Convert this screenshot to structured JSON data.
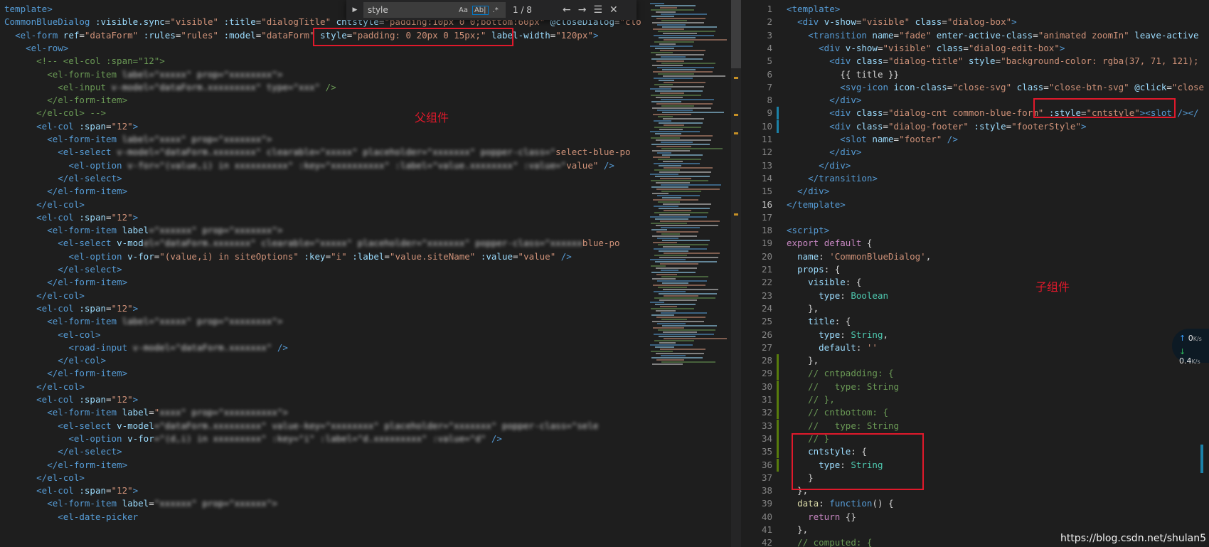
{
  "find_widget": {
    "query": "style",
    "match_count": "1 / 8",
    "option_case": "Aa",
    "option_word": "Ab|",
    "option_regex": ".*"
  },
  "annotations": {
    "parent_label": "父组件",
    "child_label": "子组件"
  },
  "left_code": [
    [
      [
        "tag",
        "template>"
      ]
    ],
    [
      [
        "tag",
        "CommonBlueDialog "
      ],
      [
        "attr",
        ":visible.sync"
      ],
      [
        "pl",
        "="
      ],
      [
        "str",
        "\"visible\" "
      ],
      [
        "attr",
        ":title"
      ],
      [
        "pl",
        "="
      ],
      [
        "str",
        "\"dialogTitle\" "
      ],
      [
        "attr",
        "cntstyle"
      ],
      [
        "pl",
        "="
      ],
      [
        "str",
        "\"padding:10px 0 0;bottom:60px\" "
      ],
      [
        "attr",
        "@closeDialog"
      ],
      [
        "pl",
        "="
      ],
      [
        "str",
        "\"clo"
      ]
    ],
    [
      [
        "pl",
        "  "
      ],
      [
        "tag",
        "<el-form "
      ],
      [
        "attr",
        "ref"
      ],
      [
        "pl",
        "="
      ],
      [
        "str",
        "\"dataForm\" "
      ],
      [
        "attr",
        ":rules"
      ],
      [
        "pl",
        "="
      ],
      [
        "str",
        "\"rules\" "
      ],
      [
        "attr",
        ":model"
      ],
      [
        "pl",
        "="
      ],
      [
        "str",
        "\"dataForm\" "
      ],
      [
        "attr",
        "style"
      ],
      [
        "pl",
        "="
      ],
      [
        "str",
        "\"padding: 0 20px 0 15px;\" "
      ],
      [
        "attr",
        "label-width"
      ],
      [
        "pl",
        "="
      ],
      [
        "str",
        "\"120px\""
      ],
      [
        "tag",
        ">"
      ]
    ],
    [
      [
        "pl",
        "    "
      ],
      [
        "tag",
        "<el-row>"
      ]
    ],
    [
      [
        "pl",
        "      "
      ],
      [
        "com",
        "<!-- <el-col :span=\"12\">"
      ]
    ],
    [
      [
        "pl",
        "        "
      ],
      [
        "com",
        "<el-form-item "
      ],
      [
        "blur",
        "label=\"xxxxx\" prop=\"xxxxxxxx\">"
      ]
    ],
    [
      [
        "pl",
        "          "
      ],
      [
        "com",
        "<el-input "
      ],
      [
        "blur",
        "v-model=\"dataForm.xxxxxxxxx\" type=\"xxx\" "
      ],
      [
        "com",
        "/>"
      ]
    ],
    [
      [
        "pl",
        "        "
      ],
      [
        "com",
        "</el-form-item>"
      ]
    ],
    [
      [
        "pl",
        "      "
      ],
      [
        "com",
        "</el-col> -->"
      ]
    ],
    [
      [
        "pl",
        "      "
      ],
      [
        "tag",
        "<el-col "
      ],
      [
        "attr",
        ":span"
      ],
      [
        "pl",
        "="
      ],
      [
        "str",
        "\"12\""
      ],
      [
        "tag",
        ">"
      ]
    ],
    [
      [
        "pl",
        "        "
      ],
      [
        "tag",
        "<el-form-item "
      ],
      [
        "blur",
        "label=\"xxxx\" prop=\"xxxxxxx\">"
      ]
    ],
    [
      [
        "pl",
        "          "
      ],
      [
        "tag",
        "<el-select "
      ],
      [
        "blur",
        "v-model=\"dataForm.xxxxxxxx\" clearable=\"xxxxx\" placeholder=\"xxxxxxx\" popper-class=\""
      ],
      [
        "str",
        "select-blue-po"
      ]
    ],
    [
      [
        "pl",
        "            "
      ],
      [
        "tag",
        "<el-option "
      ],
      [
        "blur",
        "v-for=\"(value,i) in xxxxxxxxxx\" :key=\"xxxxxxxxxx\" :label=\"value.xxxxxxxx\" :value=\""
      ],
      [
        "str",
        "value\" "
      ],
      [
        "tag",
        "/>"
      ]
    ],
    [
      [
        "pl",
        "          "
      ],
      [
        "tag",
        "</el-select>"
      ]
    ],
    [
      [
        "pl",
        "        "
      ],
      [
        "tag",
        "</el-form-item>"
      ]
    ],
    [
      [
        "pl",
        "      "
      ],
      [
        "tag",
        "</el-col>"
      ]
    ],
    [
      [
        "pl",
        "      "
      ],
      [
        "tag",
        "<el-col "
      ],
      [
        "attr",
        ":span"
      ],
      [
        "pl",
        "="
      ],
      [
        "str",
        "\"12\""
      ],
      [
        "tag",
        ">"
      ]
    ],
    [
      [
        "pl",
        "        "
      ],
      [
        "tag",
        "<el-form-item "
      ],
      [
        "attr",
        "label"
      ],
      [
        "blur",
        "=\"xxxxxx\" prop=\"xxxxxxx\">"
      ]
    ],
    [
      [
        "pl",
        "          "
      ],
      [
        "tag",
        "<el-select "
      ],
      [
        "attr",
        "v-mod"
      ],
      [
        "blur",
        "el=\"dataForm.xxxxxxx\" clearable=\"xxxxx\" placeholder=\"xxxxxxx\" popper-class=\"xxxxxx"
      ],
      [
        "str",
        "blue-po"
      ]
    ],
    [
      [
        "pl",
        "            "
      ],
      [
        "tag",
        "<el-option "
      ],
      [
        "attr",
        "v-for"
      ],
      [
        "pl",
        "="
      ],
      [
        "str",
        "\"(value,i) in siteOptions\" "
      ],
      [
        "attr",
        ":key"
      ],
      [
        "pl",
        "="
      ],
      [
        "str",
        "\"i\" "
      ],
      [
        "attr",
        ":label"
      ],
      [
        "pl",
        "="
      ],
      [
        "str",
        "\"value.siteName\" "
      ],
      [
        "attr",
        ":value"
      ],
      [
        "pl",
        "="
      ],
      [
        "str",
        "\"value\" "
      ],
      [
        "tag",
        "/>"
      ]
    ],
    [
      [
        "pl",
        "          "
      ],
      [
        "tag",
        "</el-select>"
      ]
    ],
    [
      [
        "pl",
        "        "
      ],
      [
        "tag",
        "</el-form-item>"
      ]
    ],
    [
      [
        "pl",
        "      "
      ],
      [
        "tag",
        "</el-col>"
      ]
    ],
    [
      [
        "pl",
        "      "
      ],
      [
        "tag",
        "<el-col "
      ],
      [
        "attr",
        ":span"
      ],
      [
        "pl",
        "="
      ],
      [
        "str",
        "\"12\""
      ],
      [
        "tag",
        ">"
      ]
    ],
    [
      [
        "pl",
        "        "
      ],
      [
        "tag",
        "<el-form-item "
      ],
      [
        "blur",
        "label=\"xxxxx\" prop=\"xxxxxxxx\">"
      ]
    ],
    [
      [
        "pl",
        "          "
      ],
      [
        "tag",
        "<el-col>"
      ]
    ],
    [
      [
        "pl",
        "            "
      ],
      [
        "tag",
        "<road-input "
      ],
      [
        "blur",
        "v-model=\"dataForm.xxxxxxx\" "
      ],
      [
        "tag",
        "/>"
      ]
    ],
    [
      [
        "pl",
        "          "
      ],
      [
        "tag",
        "</el-col>"
      ]
    ],
    [
      [
        "pl",
        "        "
      ],
      [
        "tag",
        "</el-form-item>"
      ]
    ],
    [
      [
        "pl",
        "      "
      ],
      [
        "tag",
        "</el-col>"
      ]
    ],
    [
      [
        "pl",
        "      "
      ],
      [
        "tag",
        "<el-col "
      ],
      [
        "attr",
        ":span"
      ],
      [
        "pl",
        "="
      ],
      [
        "str",
        "\"12\""
      ],
      [
        "tag",
        ">"
      ]
    ],
    [
      [
        "pl",
        "        "
      ],
      [
        "tag",
        "<el-form-item "
      ],
      [
        "attr",
        "label"
      ],
      [
        "pl",
        "="
      ],
      [
        "str",
        "\""
      ],
      [
        "blur",
        "xxxx\" prop=\"xxxxxxxxxx\">"
      ]
    ],
    [
      [
        "pl",
        "          "
      ],
      [
        "tag",
        "<el-select "
      ],
      [
        "attr",
        "v-model"
      ],
      [
        "blur",
        "=\"dataForm.xxxxxxxxx\" value-key=\"xxxxxxxx\" placeholder=\"xxxxxxx\" popper-class=\"sele"
      ]
    ],
    [
      [
        "pl",
        "            "
      ],
      [
        "tag",
        "<el-option "
      ],
      [
        "attr",
        "v-for"
      ],
      [
        "blur",
        "=\"(d,i) in xxxxxxxxx\" :key=\"i\" :label=\"d.xxxxxxxxx\" :value=\"d\" "
      ],
      [
        "tag",
        "/>"
      ]
    ],
    [
      [
        "pl",
        "          "
      ],
      [
        "tag",
        "</el-select>"
      ]
    ],
    [
      [
        "pl",
        "        "
      ],
      [
        "tag",
        "</el-form-item>"
      ]
    ],
    [
      [
        "pl",
        "      "
      ],
      [
        "tag",
        "</el-col>"
      ]
    ],
    [
      [
        "pl",
        "      "
      ],
      [
        "tag",
        "<el-col "
      ],
      [
        "attr",
        ":span"
      ],
      [
        "pl",
        "="
      ],
      [
        "str",
        "\"12\""
      ],
      [
        "tag",
        ">"
      ]
    ],
    [
      [
        "pl",
        "        "
      ],
      [
        "tag",
        "<el-form-item "
      ],
      [
        "attr",
        "label"
      ],
      [
        "pl",
        "="
      ],
      [
        "blur",
        "\"xxxxxx\" prop=\"xxxxxx\">"
      ]
    ],
    [
      [
        "pl",
        "          "
      ],
      [
        "tag",
        "<el-date-picker"
      ]
    ]
  ],
  "right_code": [
    [
      [
        "tag",
        "<template>"
      ]
    ],
    [
      [
        "pl",
        "  "
      ],
      [
        "tag",
        "<div "
      ],
      [
        "attr",
        "v-show"
      ],
      [
        "pl",
        "="
      ],
      [
        "str",
        "\"visible\" "
      ],
      [
        "attr",
        "class"
      ],
      [
        "pl",
        "="
      ],
      [
        "str",
        "\"dialog-box\""
      ],
      [
        "tag",
        ">"
      ]
    ],
    [
      [
        "pl",
        "    "
      ],
      [
        "tag",
        "<transition "
      ],
      [
        "attr",
        "name"
      ],
      [
        "pl",
        "="
      ],
      [
        "str",
        "\"fade\" "
      ],
      [
        "attr",
        "enter-active-class"
      ],
      [
        "pl",
        "="
      ],
      [
        "str",
        "\"animated zoomIn\" "
      ],
      [
        "attr",
        "leave-active"
      ]
    ],
    [
      [
        "pl",
        "      "
      ],
      [
        "tag",
        "<div "
      ],
      [
        "attr",
        "v-show"
      ],
      [
        "pl",
        "="
      ],
      [
        "str",
        "\"visible\" "
      ],
      [
        "attr",
        "class"
      ],
      [
        "pl",
        "="
      ],
      [
        "str",
        "\"dialog-edit-box\""
      ],
      [
        "tag",
        ">"
      ]
    ],
    [
      [
        "pl",
        "        "
      ],
      [
        "tag",
        "<div "
      ],
      [
        "attr",
        "class"
      ],
      [
        "pl",
        "="
      ],
      [
        "str",
        "\"dialog-title\" "
      ],
      [
        "attr",
        "style"
      ],
      [
        "pl",
        "="
      ],
      [
        "str",
        "\"background-color: rgba(37, 71, 121);"
      ]
    ],
    [
      [
        "pl",
        "          "
      ],
      [
        "pl",
        "{{ title }}"
      ]
    ],
    [
      [
        "pl",
        "          "
      ],
      [
        "tag",
        "<svg-icon "
      ],
      [
        "attr",
        "icon-class"
      ],
      [
        "pl",
        "="
      ],
      [
        "str",
        "\"close-svg\" "
      ],
      [
        "attr",
        "class"
      ],
      [
        "pl",
        "="
      ],
      [
        "str",
        "\"close-btn-svg\" "
      ],
      [
        "attr",
        "@click"
      ],
      [
        "pl",
        "="
      ],
      [
        "str",
        "\"close"
      ]
    ],
    [
      [
        "pl",
        "        "
      ],
      [
        "tag",
        "</div>"
      ]
    ],
    [
      [
        "pl",
        "        "
      ],
      [
        "tag",
        "<div "
      ],
      [
        "attr",
        "class"
      ],
      [
        "pl",
        "="
      ],
      [
        "str",
        "\"dialog-cnt common-blue-form\" "
      ],
      [
        "attr",
        ":style"
      ],
      [
        "pl",
        "="
      ],
      [
        "str",
        "\"cntstyle\""
      ],
      [
        "tag",
        "><slot /></"
      ]
    ],
    [
      [
        "pl",
        "        "
      ],
      [
        "tag",
        "<div "
      ],
      [
        "attr",
        "class"
      ],
      [
        "pl",
        "="
      ],
      [
        "str",
        "\"dialog-footer\" "
      ],
      [
        "attr",
        ":style"
      ],
      [
        "pl",
        "="
      ],
      [
        "str",
        "\"footerStyle\""
      ],
      [
        "tag",
        ">"
      ]
    ],
    [
      [
        "pl",
        "          "
      ],
      [
        "tag",
        "<slot "
      ],
      [
        "attr",
        "name"
      ],
      [
        "pl",
        "="
      ],
      [
        "str",
        "\"footer\" "
      ],
      [
        "tag",
        "/>"
      ]
    ],
    [
      [
        "pl",
        "        "
      ],
      [
        "tag",
        "</div>"
      ]
    ],
    [
      [
        "pl",
        "      "
      ],
      [
        "tag",
        "</div>"
      ]
    ],
    [
      [
        "pl",
        "    "
      ],
      [
        "tag",
        "</transition>"
      ]
    ],
    [
      [
        "pl",
        "  "
      ],
      [
        "tag",
        "</div>"
      ]
    ],
    [
      [
        "tag",
        "</template>"
      ]
    ],
    [
      [
        "pl",
        ""
      ]
    ],
    [
      [
        "tag",
        "<script>"
      ]
    ],
    [
      [
        "kw",
        "export "
      ],
      [
        "kw",
        "default "
      ],
      [
        "pl",
        "{"
      ]
    ],
    [
      [
        "pl",
        "  "
      ],
      [
        "attr",
        "name"
      ],
      [
        "pl",
        ": "
      ],
      [
        "str",
        "'CommonBlueDialog'"
      ],
      [
        "pl",
        ","
      ]
    ],
    [
      [
        "pl",
        "  "
      ],
      [
        "attr",
        "props"
      ],
      [
        "pl",
        ": {"
      ]
    ],
    [
      [
        "pl",
        "    "
      ],
      [
        "attr",
        "visible"
      ],
      [
        "pl",
        ": {"
      ]
    ],
    [
      [
        "pl",
        "      "
      ],
      [
        "attr",
        "type"
      ],
      [
        "pl",
        ": "
      ],
      [
        "ty",
        "Boolean"
      ]
    ],
    [
      [
        "pl",
        "    },"
      ]
    ],
    [
      [
        "pl",
        "    "
      ],
      [
        "attr",
        "title"
      ],
      [
        "pl",
        ": {"
      ]
    ],
    [
      [
        "pl",
        "      "
      ],
      [
        "attr",
        "type"
      ],
      [
        "pl",
        ": "
      ],
      [
        "ty",
        "String"
      ],
      [
        "pl",
        ","
      ]
    ],
    [
      [
        "pl",
        "      "
      ],
      [
        "attr",
        "default"
      ],
      [
        "pl",
        ": "
      ],
      [
        "str",
        "''"
      ]
    ],
    [
      [
        "pl",
        "    },"
      ]
    ],
    [
      [
        "pl",
        "    "
      ],
      [
        "com",
        "// cntpadding: {"
      ]
    ],
    [
      [
        "pl",
        "    "
      ],
      [
        "com",
        "//   type: String"
      ]
    ],
    [
      [
        "pl",
        "    "
      ],
      [
        "com",
        "// },"
      ]
    ],
    [
      [
        "pl",
        "    "
      ],
      [
        "com",
        "// cntbottom: {"
      ]
    ],
    [
      [
        "pl",
        "    "
      ],
      [
        "com",
        "//   type: String"
      ]
    ],
    [
      [
        "pl",
        "    "
      ],
      [
        "com",
        "// }"
      ]
    ],
    [
      [
        "pl",
        "    "
      ],
      [
        "attr",
        "cntstyle"
      ],
      [
        "pl",
        ": {"
      ]
    ],
    [
      [
        "pl",
        "      "
      ],
      [
        "attr",
        "type"
      ],
      [
        "pl",
        ": "
      ],
      [
        "ty",
        "String"
      ]
    ],
    [
      [
        "pl",
        "    }"
      ]
    ],
    [
      [
        "pl",
        "  },"
      ]
    ],
    [
      [
        "pl",
        "  "
      ],
      [
        "fn",
        "data"
      ],
      [
        "pl",
        ": "
      ],
      [
        "kw2",
        "function"
      ],
      [
        "pl",
        "() {"
      ]
    ],
    [
      [
        "pl",
        "    "
      ],
      [
        "kw",
        "return "
      ],
      [
        "pl",
        "{}"
      ]
    ],
    [
      [
        "pl",
        "  },"
      ]
    ],
    [
      [
        "pl",
        "  "
      ],
      [
        "com",
        "// computed: {"
      ]
    ]
  ],
  "right_line_numbers": [
    "1",
    "2",
    "3",
    "4",
    "5",
    "6",
    "7",
    "8",
    "9",
    "10",
    "11",
    "12",
    "13",
    "14",
    "15",
    "16",
    "17",
    "18",
    "19",
    "20",
    "21",
    "22",
    "23",
    "24",
    "25",
    "26",
    "27",
    "28",
    "29",
    "30",
    "31",
    "32",
    "33",
    "34",
    "35",
    "36",
    "37",
    "38",
    "39",
    "40",
    "41",
    "42"
  ],
  "active_line": "16",
  "net_widget": {
    "up_value": "0",
    "up_unit": "K/s",
    "down_value": "0.4",
    "down_unit": "K/s"
  },
  "watermark": "https://blog.csdn.net/shulan5"
}
